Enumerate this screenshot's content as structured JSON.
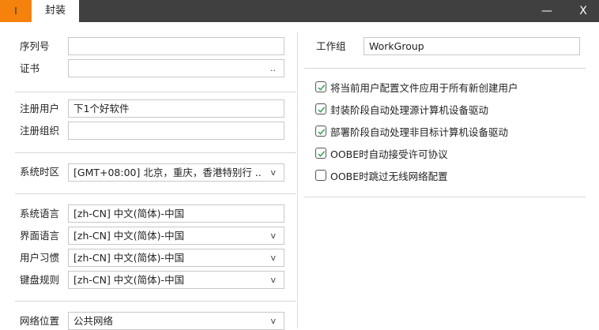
{
  "titlebar": {
    "orange_tab": "I",
    "active_tab": "封装",
    "minimize": "—",
    "close": "X"
  },
  "left": {
    "serial": {
      "label": "序列号",
      "value": ""
    },
    "cert": {
      "label": "证书",
      "value": "",
      "button": ".."
    },
    "reg_user": {
      "label": "注册用户",
      "value": "下1个好软件"
    },
    "reg_org": {
      "label": "注册组织",
      "value": ""
    },
    "timezone": {
      "label": "系统时区",
      "value": "[GMT+08:00] 北京，重庆，香港特别行 ..",
      "arrow": "v"
    },
    "sys_lang": {
      "label": "系统语言",
      "value": "[zh-CN] 中文(简体)-中国"
    },
    "ui_lang": {
      "label": "界面语言",
      "value": "[zh-CN] 中文(简体)-中国",
      "arrow": "v"
    },
    "user_locale": {
      "label": "用户习惯",
      "value": "[zh-CN] 中文(简体)-中国",
      "arrow": "v"
    },
    "keyboard": {
      "label": "键盘规则",
      "value": "[zh-CN] 中文(简体)-中国",
      "arrow": "v"
    },
    "network": {
      "label": "网络位置",
      "value": "公共网络",
      "arrow": "v"
    }
  },
  "right": {
    "workgroup": {
      "label": "工作组",
      "value": "WorkGroup"
    },
    "options": [
      {
        "label": "将当前用户配置文件应用于所有新创建用户",
        "checked": true
      },
      {
        "label": "封装阶段自动处理源计算机设备驱动",
        "checked": true
      },
      {
        "label": "部署阶段自动处理非目标计算机设备驱动",
        "checked": true
      },
      {
        "label": "OOBE时自动接受许可协议",
        "checked": true
      },
      {
        "label": "OOBE时跳过无线网络配置",
        "checked": false
      }
    ]
  },
  "colors": {
    "accent": "#f5820d",
    "titlebar": "#404040",
    "check": "#2e9e4f"
  }
}
